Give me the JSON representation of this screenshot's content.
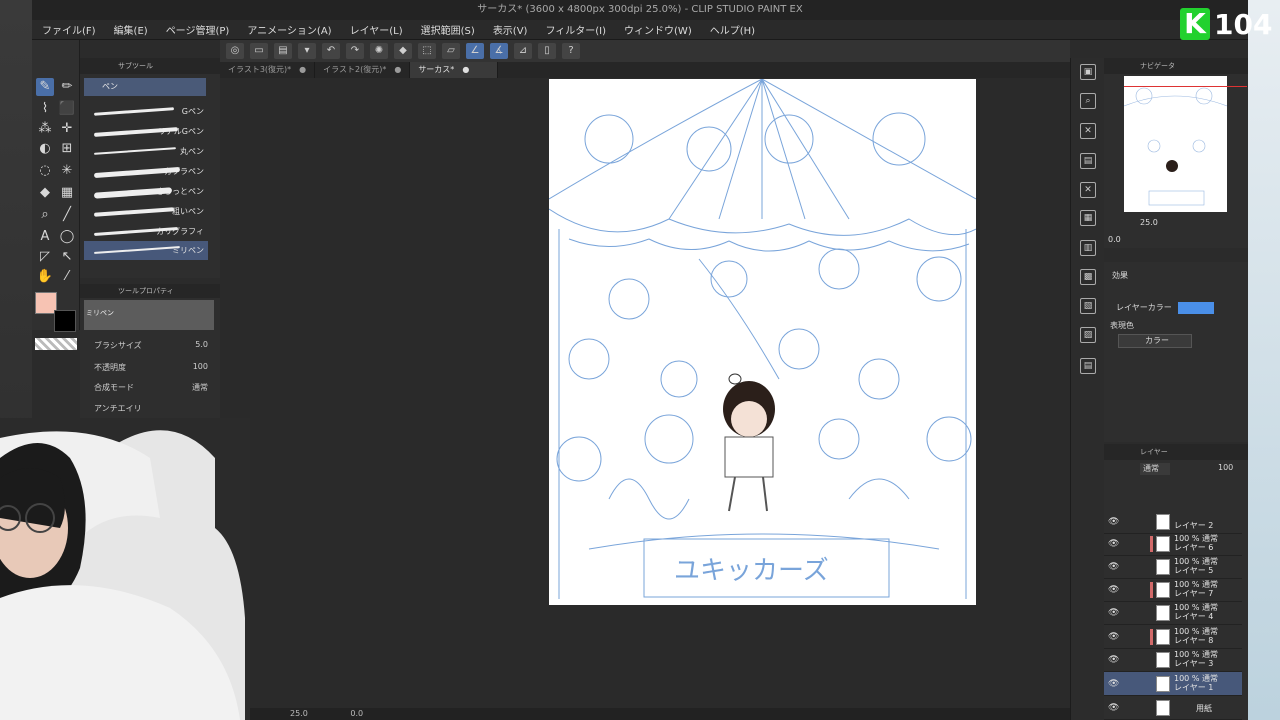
{
  "window": {
    "title": "サーカス* (3600 x 4800px 300dpi 25.0%) - CLIP STUDIO PAINT EX"
  },
  "menu": [
    "ファイル(F)",
    "編集(E)",
    "ページ管理(P)",
    "アニメーション(A)",
    "レイヤー(L)",
    "選択範囲(S)",
    "表示(V)",
    "フィルター(I)",
    "ウィンドウ(W)",
    "ヘルプ(H)"
  ],
  "tabs": [
    {
      "label": "イラスト3(復元)*"
    },
    {
      "label": "イラスト2(復元)*"
    },
    {
      "label": "サーカス*",
      "active": true
    }
  ],
  "subtool": {
    "panel_title": "サブツール",
    "group": "ペン",
    "brushes": [
      "Gペン",
      "リアルGペン",
      "丸ペン",
      "カブラペン",
      "さらっとペン",
      "粗いペン",
      "カリグラフィ",
      "ミリペン"
    ],
    "selected_brush": "ミリペン"
  },
  "tool_property": {
    "panel_title": "ツールプロパティ",
    "preview_label": "ミリペン",
    "brush_size_label": "ブラシサイズ",
    "brush_size": "5.0",
    "opacity_label": "不透明度",
    "opacity": "100",
    "blend_label": "合成モード",
    "blend_value": "通常",
    "antialias_label": "アンチエイリ"
  },
  "colors": {
    "main": "#f7c3b3",
    "sub": "#000000",
    "layer_color": "#4a8fe8"
  },
  "navigator": {
    "panel_title": "ナビゲータ",
    "zoom": "25.0",
    "rotation": "0.0"
  },
  "layer_property": {
    "effect_label": "効果",
    "layer_color_label": "レイヤーカラー",
    "expression_label": "表現色",
    "expression_value": "カラー"
  },
  "layer_panel": {
    "panel_title": "レイヤー",
    "blend": "通常",
    "opacity": "100",
    "layers": [
      {
        "mode": "",
        "name": "レイヤー 2",
        "marked": false,
        "selected": false
      },
      {
        "mode": "100 % 通常",
        "name": "レイヤー 6",
        "marked": true,
        "selected": false
      },
      {
        "mode": "100 % 通常",
        "name": "レイヤー 5",
        "marked": false,
        "selected": false
      },
      {
        "mode": "100 % 通常",
        "name": "レイヤー 7",
        "marked": true,
        "selected": false
      },
      {
        "mode": "100 % 通常",
        "name": "レイヤー 4",
        "marked": false,
        "selected": false
      },
      {
        "mode": "100 % 通常",
        "name": "レイヤー 8",
        "marked": true,
        "selected": false
      },
      {
        "mode": "100 % 通常",
        "name": "レイヤー 3",
        "marked": false,
        "selected": false
      },
      {
        "mode": "100 % 通常",
        "name": "レイヤー 1",
        "marked": false,
        "selected": true
      },
      {
        "mode": "",
        "name": "用紙",
        "marked": false,
        "selected": false
      }
    ]
  },
  "status": {
    "zoom": "25.0",
    "rotation": "0.0"
  },
  "stream_logo": {
    "letter": "K",
    "number": "104"
  },
  "canvas_text": "ユキッカーズ"
}
